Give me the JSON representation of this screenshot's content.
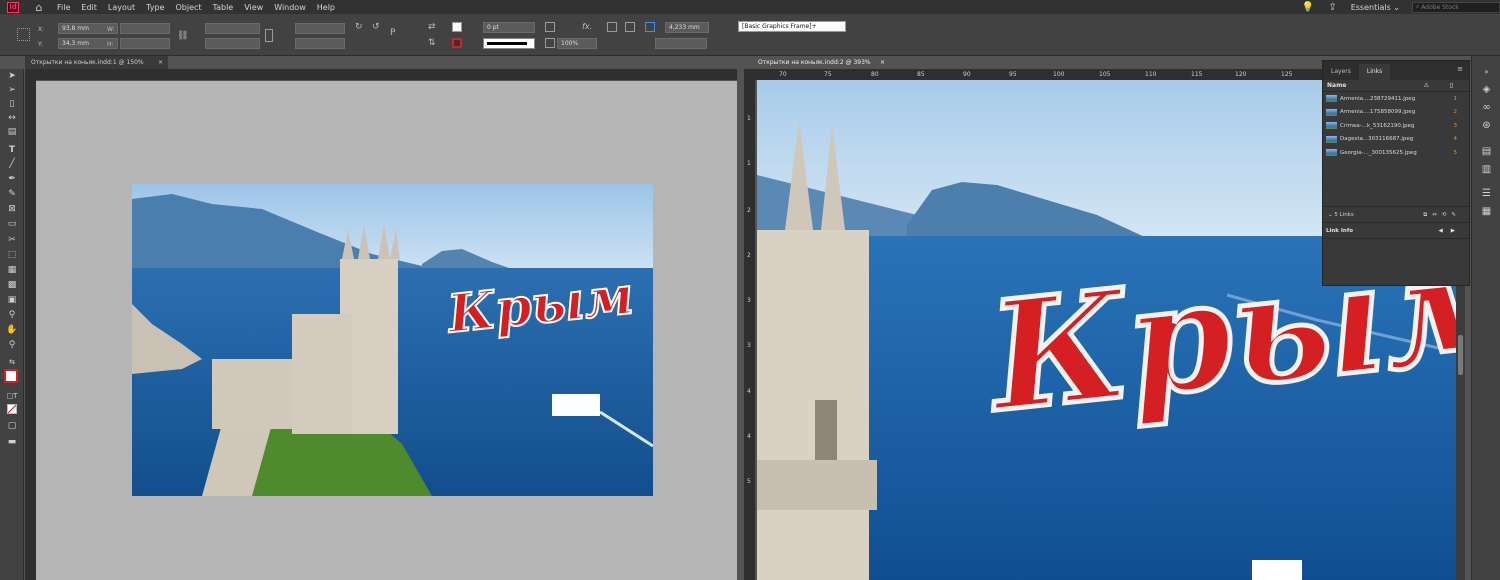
{
  "app": {
    "logo": "Id"
  },
  "menubar": {
    "items": [
      "File",
      "Edit",
      "Layout",
      "Type",
      "Object",
      "Table",
      "View",
      "Window",
      "Help"
    ],
    "workspace": "Essentials",
    "stock_placeholder": "Adobe Stock"
  },
  "controlbar": {
    "x_label": "X:",
    "x_value": "93,8 mm",
    "y_label": "Y:",
    "y_value": "34,3 mm",
    "w_label": "W:",
    "h_label": "H:",
    "stroke_weight": "0 pt",
    "scale": "100%",
    "spacing": "4,233 mm",
    "object_style": "[Basic Graphics Frame]+"
  },
  "tabs": {
    "left": "Открытки на коньяк.indd:1 @ 150%",
    "right": "Открытки на коньяк.indd:2 @ 393%"
  },
  "rulers": {
    "right_h": [
      "70",
      "75",
      "80",
      "85",
      "90",
      "95",
      "100",
      "105",
      "110",
      "115",
      "120",
      "125"
    ],
    "right_v": [
      "1",
      "1",
      "2",
      "2",
      "3",
      "3",
      "4",
      "4",
      "5"
    ]
  },
  "artwork": {
    "headline": "Крым"
  },
  "colors": {
    "headline_red": "#d41f23",
    "sea_blue": "#1f62a8",
    "sky_blue": "#a8cbea"
  },
  "links_panel": {
    "tabs": [
      "Layers",
      "Links"
    ],
    "active_tab": "Links",
    "column_name": "Name",
    "links": [
      {
        "name": "Armenia....238729411.jpeg",
        "page": "1"
      },
      {
        "name": "Armenia....175858099.jpeg",
        "page": "2"
      },
      {
        "name": "Crimea-...k_53162190.jpeg",
        "page": "3"
      },
      {
        "name": "Dagesta...303116687.jpeg",
        "page": "4"
      },
      {
        "name": "Georgia-..._300135625.jpeg",
        "page": "5"
      }
    ],
    "count_label": "5 Links",
    "link_info_label": "Link Info"
  }
}
